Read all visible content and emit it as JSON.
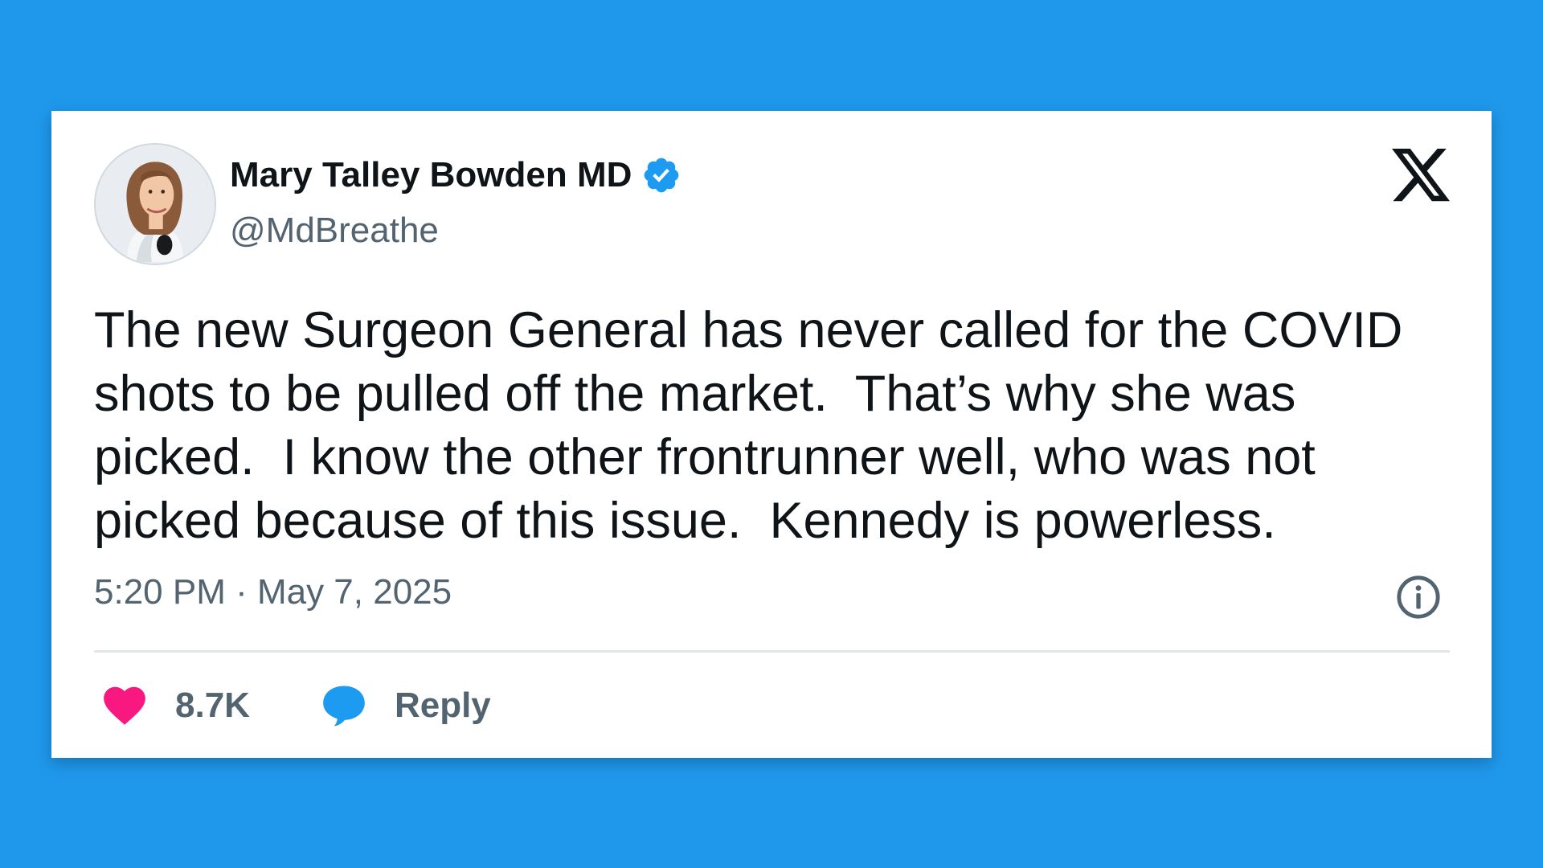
{
  "tweet": {
    "author": {
      "display_name": "Mary Talley Bowden MD",
      "handle": "@MdBreathe",
      "verified": true,
      "avatar_icon": "profile-photo"
    },
    "text": "The new Surgeon General has never called for the COVID shots to be pulled off the market.  That’s why she was picked.  I know the other frontrunner well, who was not picked because of this issue.  Kennedy is powerless.",
    "timestamp": "5:20 PM · May 7, 2025",
    "likes_label": "8.7K",
    "reply_label": "Reply"
  },
  "icons": {
    "brand": "x-logo-icon",
    "verified": "verified-badge-icon",
    "info": "info-icon",
    "like": "heart-icon",
    "reply": "speech-bubble-icon"
  },
  "colors": {
    "background": "#1f98ec",
    "card": "#ffffff",
    "text_primary": "#0f1419",
    "text_secondary": "#536471",
    "verified_blue": "#1d9bf0",
    "like_pink": "#f91880",
    "reply_blue": "#1d9bf0"
  }
}
